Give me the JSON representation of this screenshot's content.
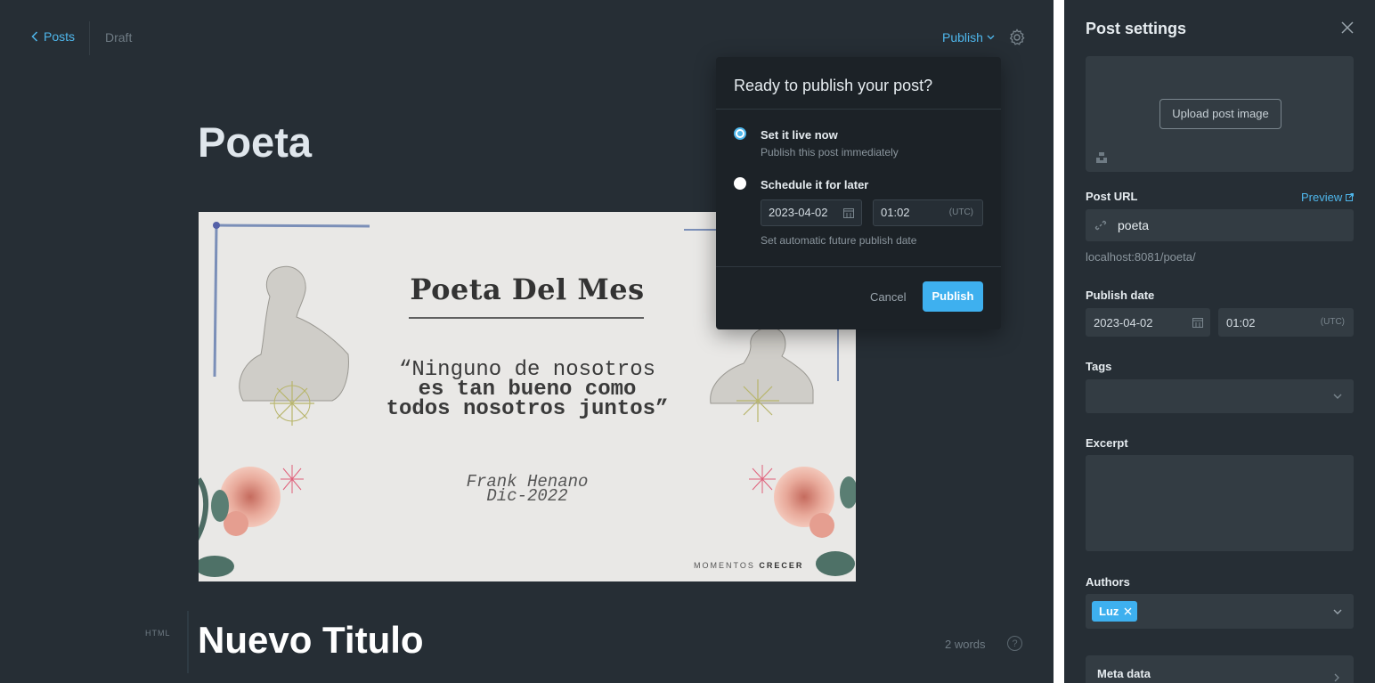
{
  "colors": {
    "accent": "#3eb0ef",
    "editor_bg": "#262e35",
    "popover_bg": "#1c2227",
    "field_bg": "#333c43"
  },
  "header": {
    "back_label": "Posts",
    "status": "Draft",
    "publish_menu_label": "Publish",
    "settings_icon": "gear-icon"
  },
  "post": {
    "title": "Poeta",
    "card_label": "HTML",
    "card_title": "Nuevo Titulo",
    "word_count": "2 words",
    "help_icon": "question-icon"
  },
  "feature_image": {
    "heading": "Poeta Del Mes",
    "quote_line1": "“Ninguno de nosotros",
    "quote_line2": "es tan bueno como",
    "quote_line3": "todos nosotros juntos”",
    "author": "Frank Henano",
    "date": "Dic-2022",
    "brand_light": "MOMENTOS",
    "brand_bold": "CRECER"
  },
  "publish_popover": {
    "title": "Ready to publish your post?",
    "option_now_label": "Set it live now",
    "option_now_desc": "Publish this post immediately",
    "option_later_label": "Schedule it for later",
    "schedule_date": "2023-04-02",
    "schedule_time": "01:02",
    "timezone": "(UTC)",
    "schedule_hint": "Set automatic future publish date",
    "cancel_label": "Cancel",
    "publish_label": "Publish",
    "selected_option": "now"
  },
  "settings": {
    "title": "Post settings",
    "upload_label": "Upload post image",
    "url_label": "Post URL",
    "preview_label": "Preview",
    "slug": "poeta",
    "url_hint": "localhost:8081/poeta/",
    "publish_date_label": "Publish date",
    "publish_date": "2023-04-02",
    "publish_time": "01:02",
    "timezone": "(UTC)",
    "tags_label": "Tags",
    "excerpt_label": "Excerpt",
    "authors_label": "Authors",
    "author": "Luz",
    "meta_label": "Meta data"
  }
}
